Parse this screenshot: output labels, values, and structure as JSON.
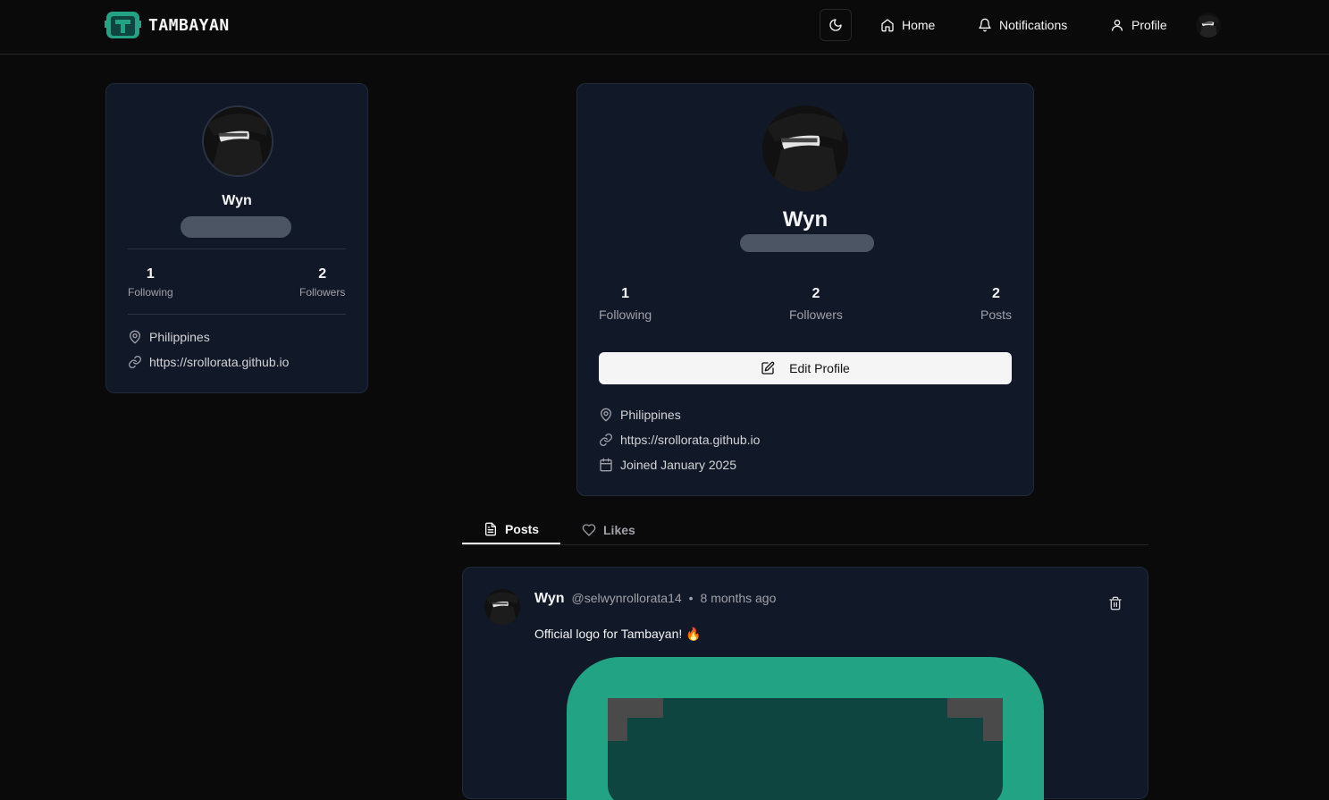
{
  "nav": {
    "brand": "TAMBAYAN",
    "home": "Home",
    "notifications": "Notifications",
    "profile": "Profile"
  },
  "sidebar_card": {
    "name": "Wyn",
    "following_count": "1",
    "following_label": "Following",
    "followers_count": "2",
    "followers_label": "Followers",
    "location": "Philippines",
    "website": "https://srollorata.github.io"
  },
  "profile_card": {
    "name": "Wyn",
    "following_count": "1",
    "following_label": "Following",
    "followers_count": "2",
    "followers_label": "Followers",
    "posts_count": "2",
    "posts_label": "Posts",
    "edit_button": "Edit Profile",
    "location": "Philippines",
    "website": "https://srollorata.github.io",
    "joined": "Joined January 2025"
  },
  "tabs": {
    "posts": "Posts",
    "likes": "Likes"
  },
  "post": {
    "author": "Wyn",
    "handle": "@selwynrollorata14",
    "separator": "•",
    "time": "8 months ago",
    "content": "Official logo for Tambayan! 🔥"
  },
  "colors": {
    "background": "#0a0a0a",
    "card": "#111827",
    "brand_green": "#22a383",
    "brand_dark_green": "#0f4540"
  },
  "icons": [
    "moon-icon",
    "home-icon",
    "bell-icon",
    "user-icon",
    "map-pin-icon",
    "link-icon",
    "calendar-icon",
    "edit-icon",
    "file-text-icon",
    "heart-icon",
    "trash-icon"
  ]
}
